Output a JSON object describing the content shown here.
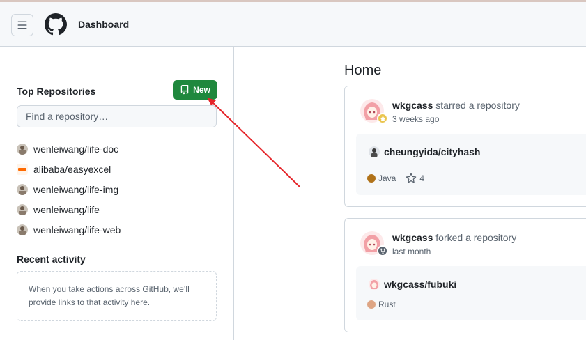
{
  "header": {
    "title": "Dashboard",
    "menu_icon": "hamburger-icon",
    "logo_icon": "github-logo-icon"
  },
  "sidebar": {
    "top_repos_title": "Top Repositories",
    "new_button_label": "New",
    "search_placeholder": "Find a repository…",
    "repos": [
      {
        "name": "wenleiwang/life-doc",
        "avatar": "user-avatar"
      },
      {
        "name": "alibaba/easyexcel",
        "avatar": "alibaba-avatar"
      },
      {
        "name": "wenleiwang/life-img",
        "avatar": "user-avatar"
      },
      {
        "name": "wenleiwang/life",
        "avatar": "user-avatar"
      },
      {
        "name": "wenleiwang/life-web",
        "avatar": "user-avatar"
      }
    ],
    "recent_activity_title": "Recent activity",
    "recent_activity_text": "When you take actions across GitHub, we’ll provide links to that activity here."
  },
  "main": {
    "title": "Home",
    "feed": [
      {
        "actor": "wkgcass",
        "action": "starred a repository",
        "time": "3 weeks ago",
        "badge_icon": "star-icon",
        "repo": "cheungyida/cityhash",
        "language": "Java",
        "language_color": "#b07219",
        "stars": "4"
      },
      {
        "actor": "wkgcass",
        "action": "forked a repository",
        "time": "last month",
        "badge_icon": "fork-icon",
        "repo": "wkgcass/fubuki",
        "language": "Rust",
        "language_color": "#dea584"
      }
    ]
  },
  "colors": {
    "primary_button": "#1f883d",
    "annotation_arrow": "#e5252a",
    "header_bg": "#f6f8fa",
    "border": "#d0d7de"
  }
}
